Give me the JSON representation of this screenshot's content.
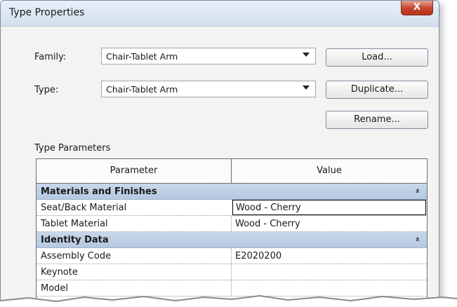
{
  "window": {
    "title": "Type Properties",
    "close_glyph": "X"
  },
  "family": {
    "label": "Family:",
    "value": "Chair-Tablet Arm"
  },
  "type": {
    "label": "Type:",
    "value": "Chair-Tablet Arm"
  },
  "buttons": {
    "load": "Load...",
    "duplicate": "Duplicate...",
    "rename": "Rename..."
  },
  "type_parameters": {
    "label": "Type Parameters",
    "headers": {
      "parameter": "Parameter",
      "value": "Value"
    },
    "groups": [
      {
        "name": "Materials and Finishes",
        "collapse_glyph": "»",
        "rows": [
          {
            "parameter": "Seat/Back Material",
            "value": "Wood - Cherry"
          },
          {
            "parameter": "Tablet Material",
            "value": "Wood - Cherry"
          }
        ]
      },
      {
        "name": "Identity Data",
        "collapse_glyph": "»",
        "rows": [
          {
            "parameter": "Assembly Code",
            "value": "E2020200"
          },
          {
            "parameter": "Keynote",
            "value": ""
          },
          {
            "parameter": "Model",
            "value": ""
          }
        ]
      }
    ]
  }
}
